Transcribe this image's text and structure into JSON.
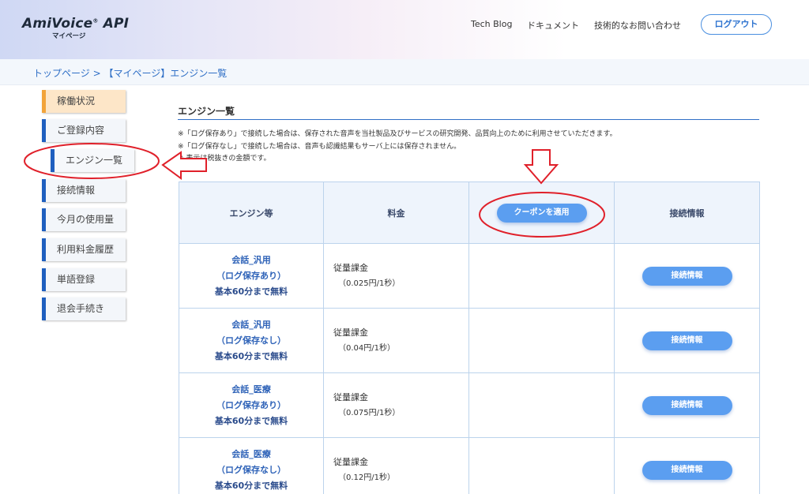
{
  "header": {
    "logo_main": "AmiVoice",
    "logo_reg": "®",
    "logo_api": " API",
    "logo_sub": "マイページ",
    "nav": [
      "Tech Blog",
      "ドキュメント",
      "技術的なお問い合わせ"
    ],
    "logout_label": "ログアウト"
  },
  "breadcrumb": "トップページ > 【マイページ】エンジン一覧",
  "sidebar": {
    "items": [
      {
        "label": "稼働状況"
      },
      {
        "label": "ご登録内容"
      },
      {
        "label": "エンジン一覧"
      },
      {
        "label": "接続情報"
      },
      {
        "label": "今月の使用量"
      },
      {
        "label": "利用料金履歴"
      },
      {
        "label": "単語登録"
      },
      {
        "label": "退会手続き"
      }
    ]
  },
  "main": {
    "title": "エンジン一覧",
    "notes": [
      "※「ログ保存あり」で接続した場合は、保存された音声を当社製品及びサービスの研究開発、品質向上のために利用させていただきます。",
      "※「ログ保存なし」で接続した場合は、音声も認識結果もサーバ上には保存されません。",
      "※ 表示は税抜きの金額です。"
    ],
    "table": {
      "headers": {
        "engine": "エンジン等",
        "price": "料金",
        "coupon_button": "クーポンを適用",
        "connection": "接続情報"
      },
      "rows": [
        {
          "name": "会話_汎用",
          "log": "（ログ保存あり）",
          "free": "基本60分まで無料",
          "price_type": "従量課金",
          "price_rate": "（0.025円/1秒）",
          "button": "接続情報"
        },
        {
          "name": "会話_汎用",
          "log": "（ログ保存なし）",
          "free": "基本60分まで無料",
          "price_type": "従量課金",
          "price_rate": "（0.04円/1秒）",
          "button": "接続情報"
        },
        {
          "name": "会話_医療",
          "log": "（ログ保存あり）",
          "free": "基本60分まで無料",
          "price_type": "従量課金",
          "price_rate": "（0.075円/1秒）",
          "button": "接続情報"
        },
        {
          "name": "会話_医療",
          "log": "（ログ保存なし）",
          "free": "基本60分まで無料",
          "price_type": "従量課金",
          "price_rate": "（0.12円/1秒）",
          "button": "接続情報"
        }
      ]
    }
  },
  "colors": {
    "accent": "#2f6fc6",
    "button_blue": "#5b9ef0",
    "annotation_red": "#e0202a",
    "sidebar_orange": "#f2a43a"
  }
}
